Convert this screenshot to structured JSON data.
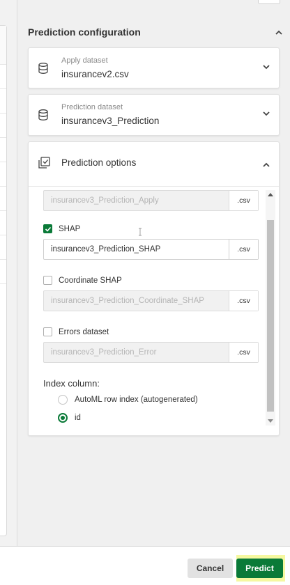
{
  "panel": {
    "section_title": "Prediction configuration"
  },
  "apply_dataset": {
    "label": "Apply dataset",
    "value": "insurancev2.csv"
  },
  "prediction_dataset": {
    "label": "Prediction dataset",
    "value": "insurancev3_Prediction"
  },
  "prediction_options": {
    "title": "Prediction options",
    "apply_field": {
      "name": "insurancev3_Prediction_Apply",
      "ext": ".csv"
    },
    "shap": {
      "label": "SHAP",
      "checked": true,
      "name": "insurancev3_Prediction_SHAP",
      "ext": ".csv"
    },
    "coordinate_shap": {
      "label": "Coordinate SHAP",
      "checked": false,
      "name": "insurancev3_Prediction_Coordinate_SHAP",
      "ext": ".csv"
    },
    "errors_dataset": {
      "label": "Errors dataset",
      "checked": false,
      "name": "insurancev3_Prediction_Error",
      "ext": ".csv"
    },
    "index_column": {
      "label": "Index column:",
      "options": [
        {
          "label": "AutoML row index (autogenerated)",
          "selected": false
        },
        {
          "label": "id",
          "selected": true
        }
      ]
    }
  },
  "footer": {
    "cancel_label": "Cancel",
    "predict_label": "Predict"
  },
  "colors": {
    "accent": "#0a7a38",
    "highlight": "#f5f8a0"
  }
}
